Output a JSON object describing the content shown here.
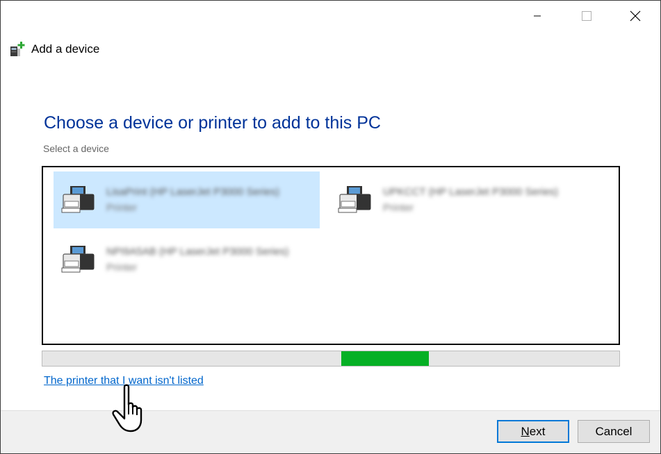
{
  "window": {
    "title": "Add a device",
    "caption_buttons": {
      "minimize_icon": "minimize-icon",
      "maximize_icon": "maximize-icon",
      "close_icon": "close-icon"
    },
    "app_icon": "add-device-icon"
  },
  "main": {
    "heading": "Choose a device or printer to add to this PC",
    "subheading": "Select a device"
  },
  "devices": [
    {
      "name": "LisaPrint (HP LaserJet P3000 Series)",
      "type": "Printer",
      "icon": "printer-icon",
      "selected": true
    },
    {
      "name": "UPKCCT (HP LaserJet P3000 Series)",
      "type": "Printer",
      "icon": "printer-icon",
      "selected": false
    },
    {
      "name": "NPI9A5AB (HP LaserJet P3000 Series)",
      "type": "Printer",
      "icon": "printer-icon",
      "selected": false
    }
  ],
  "progress": {
    "indeterminate": true,
    "segment_start": 0.518,
    "segment_end": 0.67,
    "color": "#06b025"
  },
  "link": {
    "label": "The printer that I want isn't listed"
  },
  "buttons": {
    "next": {
      "label_rest": "ext",
      "label_accel": "N"
    },
    "cancel": {
      "label": "Cancel"
    }
  },
  "colors": {
    "accent": "#0078d7",
    "heading": "#003399",
    "link": "#0066cc",
    "selection": "#cce8ff"
  }
}
